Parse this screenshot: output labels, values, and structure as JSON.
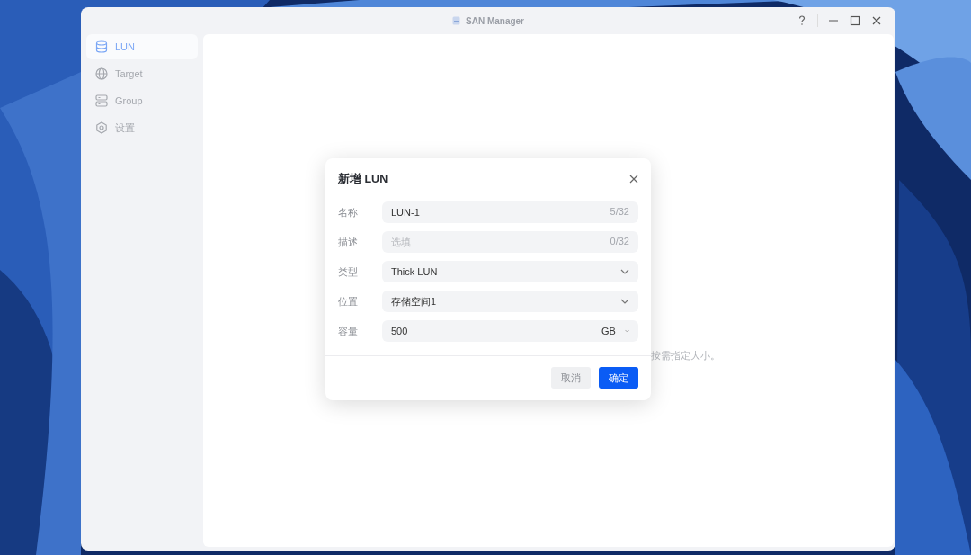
{
  "window": {
    "title": "SAN Manager"
  },
  "sidebar": {
    "items": [
      {
        "label": "LUN",
        "selected": true
      },
      {
        "label": "Target",
        "selected": false
      },
      {
        "label": "Group",
        "selected": false
      },
      {
        "label": "设置",
        "selected": false
      }
    ]
  },
  "content": {
    "hint": "按需指定大小。"
  },
  "dialog": {
    "title": "新增 LUN",
    "fields": [
      {
        "kind": "text",
        "label": "名称",
        "value": "LUN-1",
        "counter": "5/32"
      },
      {
        "kind": "text",
        "label": "描述",
        "placeholder": "选填",
        "counter": "0/32"
      },
      {
        "kind": "select",
        "label": "类型",
        "value": "Thick LUN"
      },
      {
        "kind": "select",
        "label": "位置",
        "value": "存储空间1"
      },
      {
        "kind": "number_unit",
        "label": "容量",
        "value": "500",
        "unit": "GB"
      }
    ],
    "buttons": [
      {
        "label": "取消",
        "kind": "secondary"
      },
      {
        "label": "确定",
        "kind": "primary"
      }
    ]
  }
}
